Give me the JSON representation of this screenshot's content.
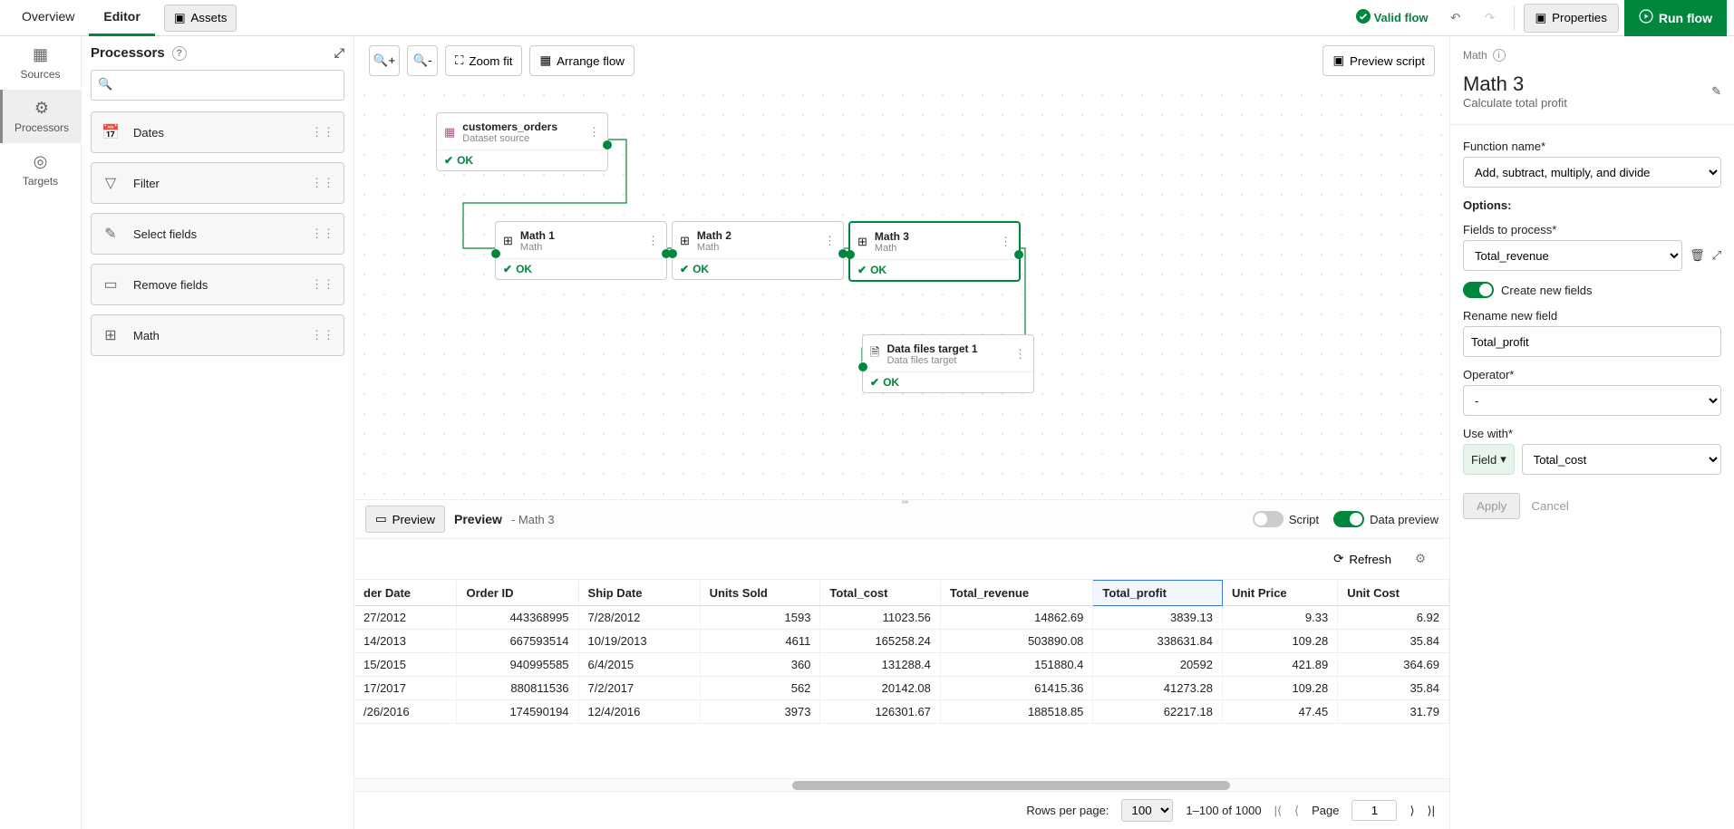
{
  "topbar": {
    "tabs": [
      "Overview",
      "Editor"
    ],
    "active_tab": 1,
    "assets": "Assets",
    "valid": "Valid flow",
    "properties": "Properties",
    "run": "Run flow"
  },
  "leftRail": {
    "items": [
      "Sources",
      "Processors",
      "Targets"
    ],
    "active": 1
  },
  "procPanel": {
    "title": "Processors",
    "items": [
      "Dates",
      "Filter",
      "Select fields",
      "Remove fields",
      "Math"
    ]
  },
  "canvasToolbar": {
    "zoomfit": "Zoom fit",
    "arrange": "Arrange flow",
    "preview": "Preview script"
  },
  "nodes": {
    "src": {
      "title": "customers_orders",
      "sub": "Dataset source",
      "status": "OK"
    },
    "m1": {
      "title": "Math 1",
      "sub": "Math",
      "status": "OK"
    },
    "m2": {
      "title": "Math 2",
      "sub": "Math",
      "status": "OK"
    },
    "m3": {
      "title": "Math 3",
      "sub": "Math",
      "status": "OK"
    },
    "tgt": {
      "title": "Data files target 1",
      "sub": "Data files target",
      "status": "OK"
    }
  },
  "previewBar": {
    "preview": "Preview",
    "label": "Preview",
    "suffix": " - Math 3",
    "script": "Script",
    "datapreview": "Data preview",
    "refresh": "Refresh"
  },
  "table": {
    "headers": [
      "der Date",
      "Order ID",
      "Ship Date",
      "Units Sold",
      "Total_cost",
      "Total_revenue",
      "Total_profit",
      "Unit Price",
      "Unit Cost"
    ],
    "selectedCol": 6,
    "rows": [
      [
        "27/2012",
        "443368995",
        "7/28/2012",
        "1593",
        "11023.56",
        "14862.69",
        "3839.13",
        "9.33",
        "6.92"
      ],
      [
        "14/2013",
        "667593514",
        "10/19/2013",
        "4611",
        "165258.24",
        "503890.08",
        "338631.84",
        "109.28",
        "35.84"
      ],
      [
        "15/2015",
        "940995585",
        "6/4/2015",
        "360",
        "131288.4",
        "151880.4",
        "20592",
        "421.89",
        "364.69"
      ],
      [
        "17/2017",
        "880811536",
        "7/2/2017",
        "562",
        "20142.08",
        "61415.36",
        "41273.28",
        "109.28",
        "35.84"
      ],
      [
        "/26/2016",
        "174590194",
        "12/4/2016",
        "3973",
        "126301.67",
        "188518.85",
        "62217.18",
        "47.45",
        "31.79"
      ]
    ]
  },
  "pager": {
    "rpp_label": "Rows per page:",
    "rpp": "100",
    "range": "1–100 of 1000",
    "page_label": "Page",
    "page": "1"
  },
  "rightPanel": {
    "crumb": "Math",
    "title": "Math 3",
    "sub": "Calculate total profit",
    "fn_label": "Function name*",
    "fn_value": "Add, subtract, multiply, and divide",
    "options": "Options:",
    "fields_label": "Fields to process*",
    "fields_value": "Total_revenue",
    "create_label": "Create new fields",
    "rename_label": "Rename new field",
    "rename_value": "Total_profit",
    "operator_label": "Operator*",
    "operator_value": "-",
    "usewith_label": "Use with*",
    "usewith_kind": "Field",
    "usewith_value": "Total_cost",
    "apply": "Apply",
    "cancel": "Cancel"
  }
}
